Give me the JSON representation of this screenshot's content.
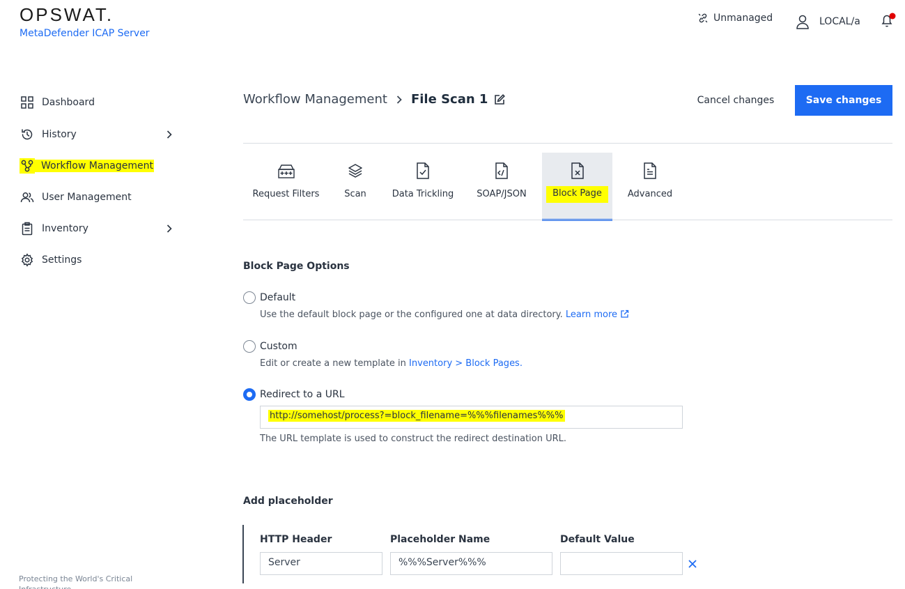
{
  "brand": {
    "logo": "OPSWAT.",
    "product": "MetaDefender ICAP Server"
  },
  "topbar": {
    "status": "Unmanaged",
    "user": "LOCAL/a",
    "icons": [
      "unlink-icon",
      "user-icon",
      "bell-icon"
    ],
    "notification_color": "#e00000"
  },
  "sidebar": {
    "items": [
      {
        "label": "Dashboard",
        "icon": "grid-icon",
        "has_chevron": false
      },
      {
        "label": "History",
        "icon": "history-icon",
        "has_chevron": true
      },
      {
        "label": "Workflow Management",
        "icon": "workflow-icon",
        "has_chevron": false,
        "selected": true
      },
      {
        "label": "User Management",
        "icon": "users-icon",
        "has_chevron": false
      },
      {
        "label": "Inventory",
        "icon": "clipboard-icon",
        "has_chevron": true
      },
      {
        "label": "Settings",
        "icon": "gear-icon",
        "has_chevron": false
      }
    ],
    "footer": "Protecting the World's Critical Infrastructure"
  },
  "header": {
    "breadcrumb_root": "Workflow Management",
    "breadcrumb_current": "File Scan 1",
    "cancel_label": "Cancel changes",
    "save_label": "Save changes"
  },
  "tabs": [
    {
      "label": "Request Filters",
      "icon": "request-filters-icon"
    },
    {
      "label": "Scan",
      "icon": "layers-icon"
    },
    {
      "label": "Data Trickling",
      "icon": "file-check-icon"
    },
    {
      "label": "SOAP/JSON",
      "icon": "file-code-icon"
    },
    {
      "label": "Block Page",
      "icon": "file-x-icon",
      "active": true
    },
    {
      "label": "Advanced",
      "icon": "file-text-icon"
    }
  ],
  "block_page": {
    "title": "Block Page Options",
    "options": [
      {
        "label": "Default",
        "checked": false,
        "help_text": "Use the default block page or the configured one at data directory.",
        "help_link": "Learn more"
      },
      {
        "label": "Custom",
        "checked": false,
        "help_text": "Edit or create a new template in",
        "help_link": "Inventory > Block Pages."
      },
      {
        "label": "Redirect to a URL",
        "checked": true
      }
    ],
    "url_value": "http://somehost/process?=block_filename=%%%filenames%%%",
    "url_help": "The URL template is used to construct the redirect destination URL."
  },
  "placeholder": {
    "title": "Add placeholder",
    "columns": [
      "HTTP Header",
      "Placeholder Name",
      "Default Value"
    ],
    "row": {
      "http_header": "Server",
      "placeholder_name": "%%%Server%%%",
      "default_value": ""
    }
  },
  "colors": {
    "accent": "#1d6bf3",
    "highlight": "#ffff00"
  }
}
